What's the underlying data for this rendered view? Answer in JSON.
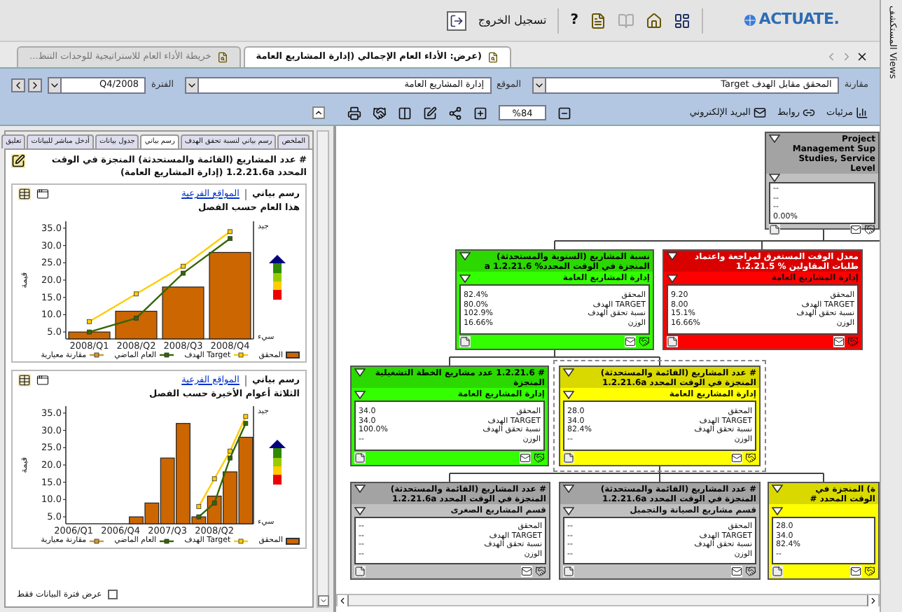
{
  "top_bar": {
    "logo": "ACTUATE.",
    "help": "?",
    "logout": "تسجيل الخروج"
  },
  "side_tab": {
    "label": "المستكشف Views"
  },
  "doc_tabs": [
    {
      "label": "(عرض: الأداء العام الإجمالي (إدارة المشاريع العامة",
      "selected": true
    },
    {
      "label": "خريطة الأداء العام للاستراتيجية للوحدات التنظ...",
      "selected": false
    }
  ],
  "filters": [
    {
      "label": "مقارنة",
      "value": "المحقق مقابل الهدف Target"
    },
    {
      "label": "الموقع",
      "value": "إدارة المشاريع العامة"
    },
    {
      "label": "الفترة",
      "value": "Q4/2008"
    }
  ],
  "toolbar": {
    "zoom": "%84",
    "email": "البريد الإلكتروني",
    "links": "روابط",
    "views": "مرئيات"
  },
  "panel": {
    "tabs": [
      {
        "label": "الملخص",
        "selected": false
      },
      {
        "label": "رسم بياني لنسبة تحقق الهدف",
        "selected": false
      },
      {
        "label": "رسم بياني",
        "selected": true
      },
      {
        "label": "جدول بيانات",
        "selected": false
      },
      {
        "label": "أدخل مباشر للبيانات",
        "selected": false
      },
      {
        "label": "تعليق",
        "selected": false
      }
    ],
    "title": "# عدد المشاريع (القائمة والمستحدثة) المنجزة في الوقت المحدد 1.2.21.6a (إدارة المشاريع العامة)",
    "charts": [
      {
        "view_label": "رسم بياني",
        "link": "المواقع الفرعية",
        "subtitle": "هذا العام حسب الفصل",
        "good": "جيد",
        "bad": "سيء",
        "chart_data": {
          "type": "bar",
          "ylabel": "قيمة",
          "categories": [
            "2008/Q1",
            "2008/Q2",
            "2008/Q3",
            "2008/Q4"
          ],
          "ylim": [
            3,
            37
          ],
          "yticks": [
            {
              "value": 5,
              "label": "5.0"
            },
            {
              "value": 10,
              "label": "10.0"
            },
            {
              "value": 15,
              "label": "15.0"
            },
            {
              "value": 20,
              "label": "20.0"
            },
            {
              "value": 25,
              "label": "25.0"
            },
            {
              "value": 30,
              "label": "30.0"
            },
            {
              "value": 35,
              "label": "35.0"
            }
          ],
          "series": [
            {
              "name": "المحقق",
              "type": "bar",
              "color": "#cc6600",
              "values": [
                5,
                11,
                18,
                28
              ]
            },
            {
              "name": "Target الهدف",
              "type": "line",
              "marker": "square",
              "color": "#ffcc00",
              "values": [
                8,
                16,
                24,
                34
              ]
            },
            {
              "name": "العام الماضي",
              "type": "line",
              "marker": "square",
              "color": "#336600",
              "values": [
                5,
                9,
                22,
                32
              ]
            },
            {
              "name": "مقارنة معيارية",
              "type": "line",
              "marker": "square",
              "color": "#cc9933",
              "values": [
                null,
                null,
                null,
                null
              ]
            }
          ]
        }
      },
      {
        "view_label": "رسم بياني",
        "link": "المواقع الفرعية",
        "subtitle": "الثلاثة أعوام الأخيرة حسب الفصل",
        "good": "جيد",
        "bad": "سيء",
        "chart_data": {
          "type": "bar",
          "ylabel": "قيمة",
          "ylim": [
            3,
            37
          ],
          "categories": [
            "2006/Q1",
            null,
            null,
            "2006/Q4",
            null,
            null,
            "2007/Q3",
            null,
            null,
            "2008/Q2",
            null,
            null
          ],
          "yticks": [
            {
              "value": 5,
              "label": "5.0"
            },
            {
              "value": 10,
              "label": "10.0"
            },
            {
              "value": 15,
              "label": "15.0"
            },
            {
              "value": 20,
              "label": "20.0"
            },
            {
              "value": 25,
              "label": "25.0"
            },
            {
              "value": 30,
              "label": "30.0"
            },
            {
              "value": 35,
              "label": "35.0"
            }
          ],
          "series": [
            {
              "name": "المحقق",
              "type": "bar",
              "color": "#cc6600",
              "values": [
                null,
                null,
                null,
                null,
                5,
                9,
                22,
                32,
                5,
                11,
                18,
                28
              ]
            },
            {
              "name": "Target الهدف",
              "type": "line",
              "marker": "square",
              "color": "#ffcc00",
              "values": [
                null,
                null,
                null,
                null,
                null,
                null,
                null,
                null,
                8,
                16,
                24,
                34
              ]
            },
            {
              "name": "العام الماضي",
              "type": "line",
              "marker": "square",
              "color": "#336600",
              "values": [
                null,
                null,
                null,
                null,
                null,
                null,
                null,
                null,
                5,
                9,
                22,
                32
              ]
            },
            {
              "name": "مقارنة معيارية",
              "type": "line",
              "marker": "square",
              "color": "#cc9933",
              "values": [
                null,
                null,
                null,
                null,
                null,
                null,
                null,
                null,
                null,
                null,
                null,
                null
              ]
            }
          ]
        }
      }
    ],
    "checkbox": {
      "label": "عرض فترة البيانات فقط",
      "checked": false
    }
  },
  "diagram": {
    "nodes": [
      {
        "title": "Project Management Sup Studies, Service Level",
        "color": "#c0c0c0",
        "selected": false,
        "metrics": [
          {
            "value": "--"
          },
          {
            "value": "--"
          },
          {
            "value": "--"
          },
          {
            "value": "0.00%"
          }
        ]
      },
      {
        "title": "معدل الوقت المستغرق لمراجعة واعتماد طلبات المقاولين % 1.2.21.5",
        "unit": "إدارة المشاريع العامة",
        "color": "#ff0000",
        "selected": false,
        "metrics": [
          {
            "label": "المحقق",
            "value": "9.20"
          },
          {
            "label": "TARGET الهدف",
            "value": "8.00"
          },
          {
            "label": "نسبة تحقق الهدف",
            "value": "15.1%"
          },
          {
            "label": "الوزن",
            "value": "16.66%"
          }
        ]
      },
      {
        "title": "نسبة المشاريع (السنوية والمستحدثة) المنجزة في الوقت المحدد% 1.2.21.6 a",
        "unit": "إدارة المشاريع العامة",
        "color": "#33ff00",
        "selected": false,
        "metrics": [
          {
            "label": "المحقق",
            "value": "82.4%"
          },
          {
            "label": "TARGET الهدف",
            "value": "80.0%"
          },
          {
            "label": "نسبة تحقق الهدف",
            "value": "102.9%"
          },
          {
            "label": "الوزن",
            "value": "16.66%"
          }
        ]
      },
      {
        "title": "# عدد المشاريع (القائمة والمستحدثة) المنجزة في الوقت المحدد 1.2.21.6a",
        "unit": "إدارة المشاريع العامة",
        "color": "#ffff00",
        "selected": true,
        "metrics": [
          {
            "label": "المحقق",
            "value": "28.0"
          },
          {
            "label": "TARGET الهدف",
            "value": "34.0"
          },
          {
            "label": "نسبة تحقق الهدف",
            "value": "82.4%"
          },
          {
            "label": "الوزن",
            "value": "--"
          }
        ]
      },
      {
        "title": "# 1.2.21.6 عدد مشاريع الخطة التشغيلية المنجزة",
        "unit": "إدارة المشاريع العامة",
        "color": "#33ff00",
        "selected": false,
        "metrics": [
          {
            "label": "المحقق",
            "value": "34.0"
          },
          {
            "label": "TARGET الهدف",
            "value": "34.0"
          },
          {
            "label": "نسبة تحقق الهدف",
            "value": "100.0%"
          },
          {
            "label": "الوزن",
            "value": "--"
          }
        ]
      },
      {
        "title": "ة) المنجزة في الوقت المحدد #",
        "color": "#ffff00",
        "selected": false,
        "metrics": [
          {
            "value": "28.0"
          },
          {
            "value": "34.0"
          },
          {
            "value": "82.4%"
          },
          {
            "value": "--"
          }
        ]
      },
      {
        "title": "# عدد المشاريع (القائمة والمستحدثة) المنجزة في الوقت المحدد 1.2.21.6a",
        "unit": "قسم مشاريع الصيانة والتجميل",
        "color": "#c0c0c0",
        "selected": false,
        "metrics": [
          {
            "label": "المحقق",
            "value": "--"
          },
          {
            "label": "TARGET الهدف",
            "value": "--"
          },
          {
            "label": "نسبة تحقق الهدف",
            "value": "--"
          },
          {
            "label": "الوزن",
            "value": "--"
          }
        ]
      },
      {
        "title": "# عدد المشاريع (القائمة والمستحدثة) المنجزة في الوقت المحدد 1.2.21.6a",
        "unit": "قسم المشاريع الصغرى",
        "color": "#c0c0c0",
        "selected": false,
        "metrics": [
          {
            "label": "المحقق",
            "value": "--"
          },
          {
            "label": "TARGET الهدف",
            "value": "--"
          },
          {
            "label": "نسبة تحقق الهدف",
            "value": "--"
          },
          {
            "label": "الوزن",
            "value": "--"
          }
        ]
      }
    ]
  }
}
